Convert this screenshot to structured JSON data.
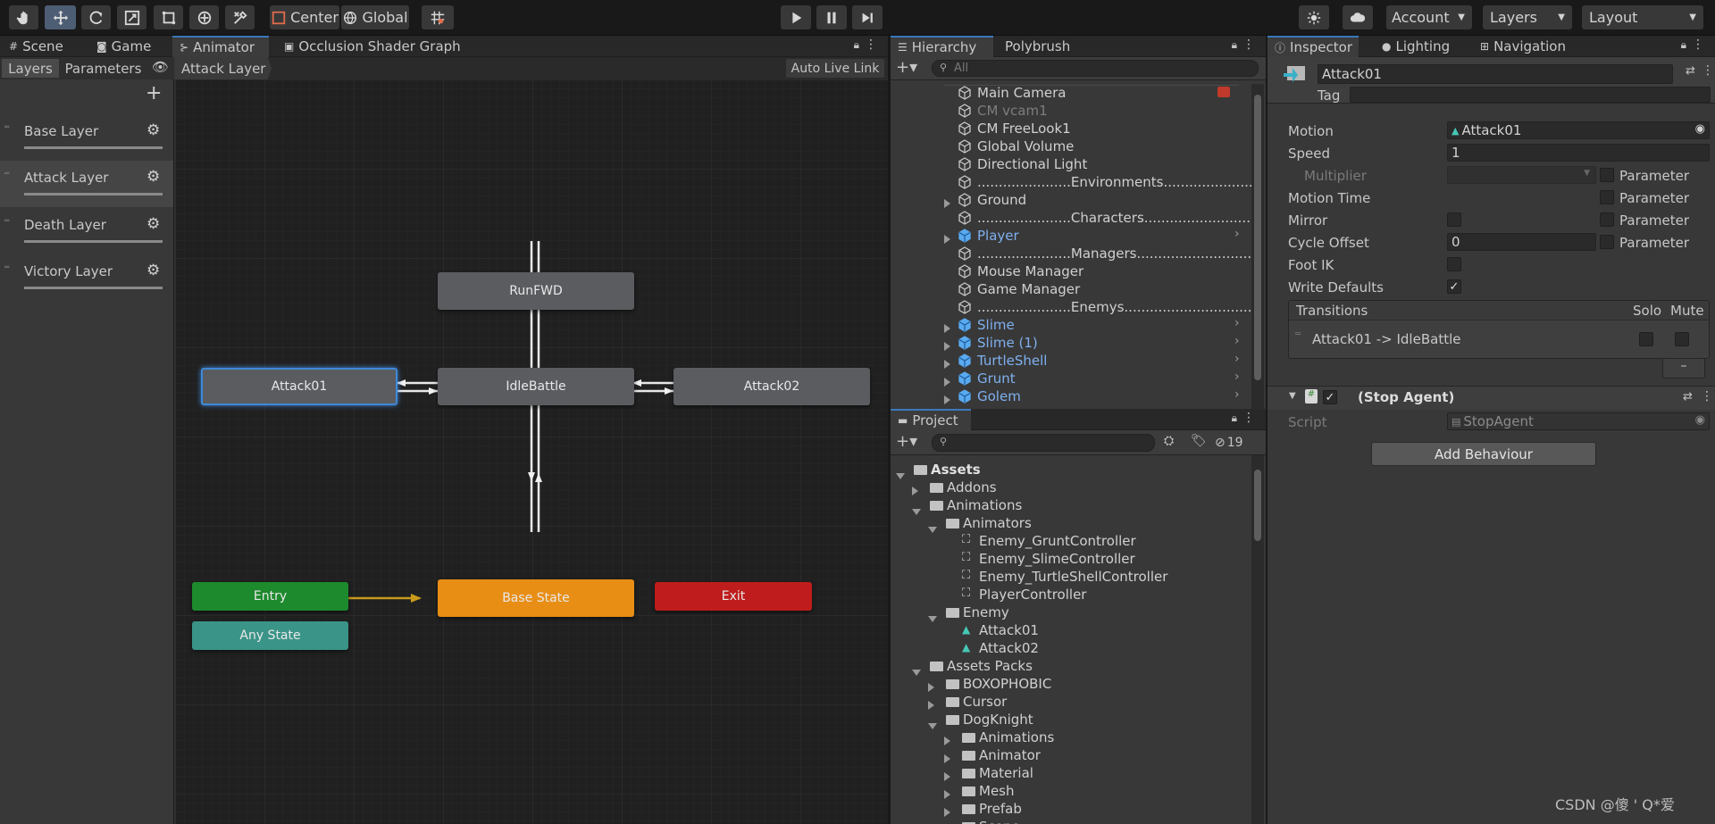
{
  "toolbar": {
    "center_label": "Center",
    "global_label": "Global",
    "account_label": "Account",
    "layers_label": "Layers",
    "layout_label": "Layout"
  },
  "left_tabs": {
    "scene": "Scene",
    "game": "Game",
    "animator": "Animator",
    "occlusion": "Occlusion Shader Graph"
  },
  "animator": {
    "layers_tab": "Layers",
    "parameters_tab": "Parameters",
    "breadcrumb": "Attack Layer",
    "auto_live_link": "Auto Live Link",
    "layers": [
      "Base Layer",
      "Attack Layer",
      "Death Layer",
      "Victory Layer"
    ],
    "states": {
      "runfwd": "RunFWD",
      "attack01": "Attack01",
      "idlebattle": "IdleBattle",
      "attack02": "Attack02",
      "entry": "Entry",
      "base_state": "Base State",
      "exit": "Exit",
      "any_state": "Any State"
    }
  },
  "hierarchy": {
    "tab": "Hierarchy",
    "tab2": "Polybrush",
    "search_placeholder": "All",
    "items": [
      {
        "label": "Main Camera",
        "style": "normal"
      },
      {
        "label": "CM vcam1",
        "style": "dim"
      },
      {
        "label": "CM FreeLook1",
        "style": "normal"
      },
      {
        "label": "Global Volume",
        "style": "normal"
      },
      {
        "label": "Directional Light",
        "style": "normal"
      },
      {
        "label": "......................Environments............................",
        "style": "normal"
      },
      {
        "label": "Ground",
        "style": "normal"
      },
      {
        "label": "......................Characters...............................",
        "style": "normal"
      },
      {
        "label": "Player",
        "style": "blue"
      },
      {
        "label": "......................Managers................................",
        "style": "normal"
      },
      {
        "label": "Mouse Manager",
        "style": "normal"
      },
      {
        "label": "Game Manager",
        "style": "normal"
      },
      {
        "label": "......................Enemys...............................",
        "style": "normal"
      },
      {
        "label": "Slime",
        "style": "blue"
      },
      {
        "label": "Slime (1)",
        "style": "blue"
      },
      {
        "label": "TurtleShell",
        "style": "blue"
      },
      {
        "label": "Grunt",
        "style": "blue"
      },
      {
        "label": "Golem",
        "style": "blue"
      }
    ]
  },
  "project": {
    "tab": "Project",
    "hidden_count": "19",
    "items": [
      {
        "label": "Assets",
        "kind": "folder",
        "bold": true
      },
      {
        "label": "Addons",
        "kind": "folder"
      },
      {
        "label": "Animations",
        "kind": "folder"
      },
      {
        "label": "Animators",
        "kind": "folder"
      },
      {
        "label": "Enemy_GruntController",
        "kind": "controller"
      },
      {
        "label": "Enemy_SlimeController",
        "kind": "controller"
      },
      {
        "label": "Enemy_TurtleShellController",
        "kind": "controller"
      },
      {
        "label": "PlayerController",
        "kind": "controller"
      },
      {
        "label": "Enemy",
        "kind": "folder"
      },
      {
        "label": "Attack01",
        "kind": "clip"
      },
      {
        "label": "Attack02",
        "kind": "clip"
      },
      {
        "label": "Assets Packs",
        "kind": "folder"
      },
      {
        "label": "BOXOPHOBIC",
        "kind": "folder"
      },
      {
        "label": "Cursor",
        "kind": "folder"
      },
      {
        "label": "DogKnight",
        "kind": "folder"
      },
      {
        "label": "Animations",
        "kind": "folder"
      },
      {
        "label": "Animator",
        "kind": "folder"
      },
      {
        "label": "Material",
        "kind": "folder"
      },
      {
        "label": "Mesh",
        "kind": "folder"
      },
      {
        "label": "Prefab",
        "kind": "folder"
      },
      {
        "label": "Scene",
        "kind": "folder"
      }
    ]
  },
  "inspector": {
    "tab": "Inspector",
    "lighting_tab": "Lighting",
    "navigation_tab": "Navigation",
    "object_name": "Attack01",
    "tag_label": "Tag",
    "motion_label": "Motion",
    "motion_value": "Attack01",
    "speed_label": "Speed",
    "speed_value": "1",
    "multiplier_label": "Multiplier",
    "motion_time_label": "Motion Time",
    "mirror_label": "Mirror",
    "cycle_offset_label": "Cycle Offset",
    "cycle_offset_value": "0",
    "foot_ik_label": "Foot IK",
    "write_defaults_label": "Write Defaults",
    "parameter_label": "Parameter",
    "transitions_label": "Transitions",
    "solo_label": "Solo",
    "mute_label": "Mute",
    "transition_item": "Attack01 -> IdleBattle",
    "behaviour_title": "(Stop Agent)",
    "script_label": "Script",
    "script_value": "StopAgent",
    "add_behaviour": "Add Behaviour"
  },
  "watermark": "CSDN @傻 ' Q*爱"
}
